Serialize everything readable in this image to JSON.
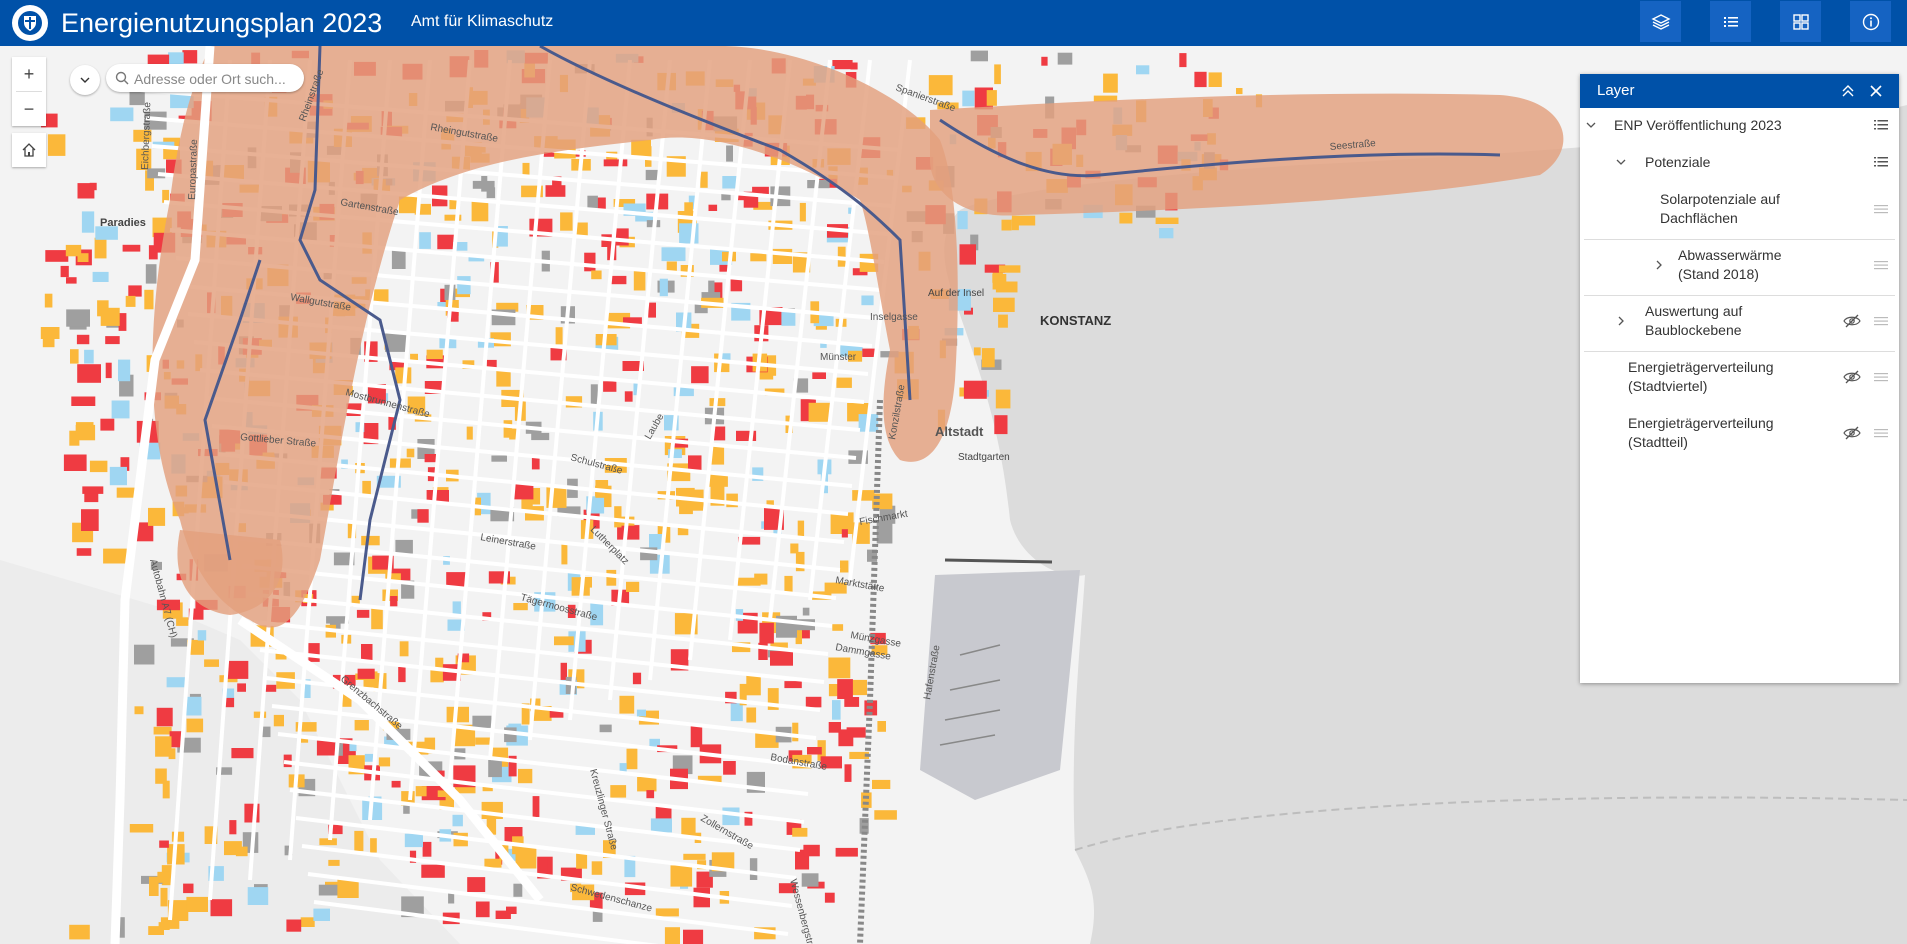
{
  "header": {
    "title": "Energienutzungsplan 2023",
    "subtitle": "Amt für Klimaschutz",
    "buttons": [
      "layers-icon",
      "legend-icon",
      "basemap-icon",
      "info-icon"
    ]
  },
  "search": {
    "placeholder": "Adresse oder Ort such..."
  },
  "zoom": {
    "in": "+",
    "out": "−"
  },
  "colors": {
    "header": "#0051a8",
    "heat_zone": "#e3a07e",
    "solar_high": "#ef3b42",
    "solar_mid": "#fbb83a",
    "solar_low": "#9fd6f2",
    "buildings": "#9f9f9f",
    "water": "#d6d6d6"
  },
  "layer_panel": {
    "title": "Layer",
    "items": [
      {
        "label": "ENP Veröffentlichung 2023",
        "expanded": true
      },
      {
        "label": "Potenziale",
        "expanded": true
      },
      {
        "label_1": "Solarpotenziale auf",
        "label_2": "Dachflächen"
      },
      {
        "label_1": "Abwasserwärme",
        "label_2": "(Stand 2018)"
      },
      {
        "label_1": "Auswertung auf",
        "label_2": "Baublockebene",
        "visible": false
      },
      {
        "label_1": "Energieträgerverteilung",
        "label_2": "(Stadtviertel)",
        "visible": false
      },
      {
        "label_1": "Energieträgerverteilung",
        "label_2": "(Stadtteil)",
        "visible": false
      }
    ]
  },
  "map_labels": {
    "konstanz": "KONSTANZ",
    "altstadt": "Altstadt",
    "paradies": "Paradies",
    "stadtgarten": "Stadtgarten",
    "auf_der_insel": "Auf der Insel",
    "streets": [
      "Rheinstraße",
      "Rheingutstraße",
      "Gartenstraße",
      "Wallgutstraße",
      "Mostbrunnenstraße",
      "Gottlieber Straße",
      "Laube",
      "Schulstraße",
      "Lutherplatz",
      "Leinerstraße",
      "Tägermoosstraße",
      "Marktstätte",
      "Fischmarkt",
      "Bodanstraße",
      "Hafenstraße",
      "Kreuzlinger Straße",
      "Schwedenschanze",
      "Grenzbachstraße",
      "Europastraße",
      "Eichbergstraße",
      "Spanierstraße",
      "Seestraße",
      "Münster",
      "Konzilstraße",
      "Inselgasse",
      "Zollernstraße",
      "Autobahn A7 (CH)",
      "Münzgasse",
      "Dammgasse",
      "Wessenbergstraße"
    ]
  }
}
